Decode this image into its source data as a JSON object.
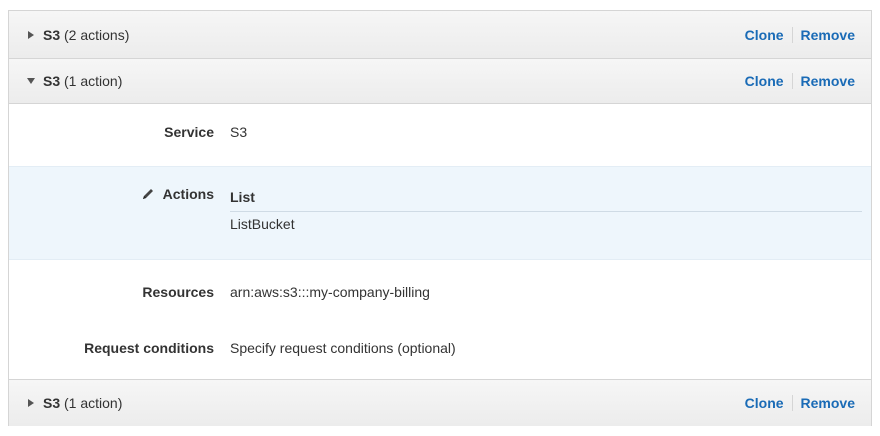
{
  "blocks": [
    {
      "service": "S3",
      "count": "(2 actions)",
      "clone": "Clone",
      "remove": "Remove"
    },
    {
      "service": "S3",
      "count": "(1 action)",
      "clone": "Clone",
      "remove": "Remove"
    },
    {
      "service": "S3",
      "count": "(1 action)",
      "clone": "Clone",
      "remove": "Remove"
    }
  ],
  "details": {
    "service_label": "Service",
    "service_value": "S3",
    "actions_label": "Actions",
    "actions_group": "List",
    "actions_value": "ListBucket",
    "resources_label": "Resources",
    "resources_value": "arn:aws:s3:::my-company-billing",
    "conditions_label": "Request conditions",
    "conditions_link": "Specify request conditions (optional)"
  },
  "colors": {
    "link": "#1a6bb6",
    "highlight": "#eef6fc"
  }
}
